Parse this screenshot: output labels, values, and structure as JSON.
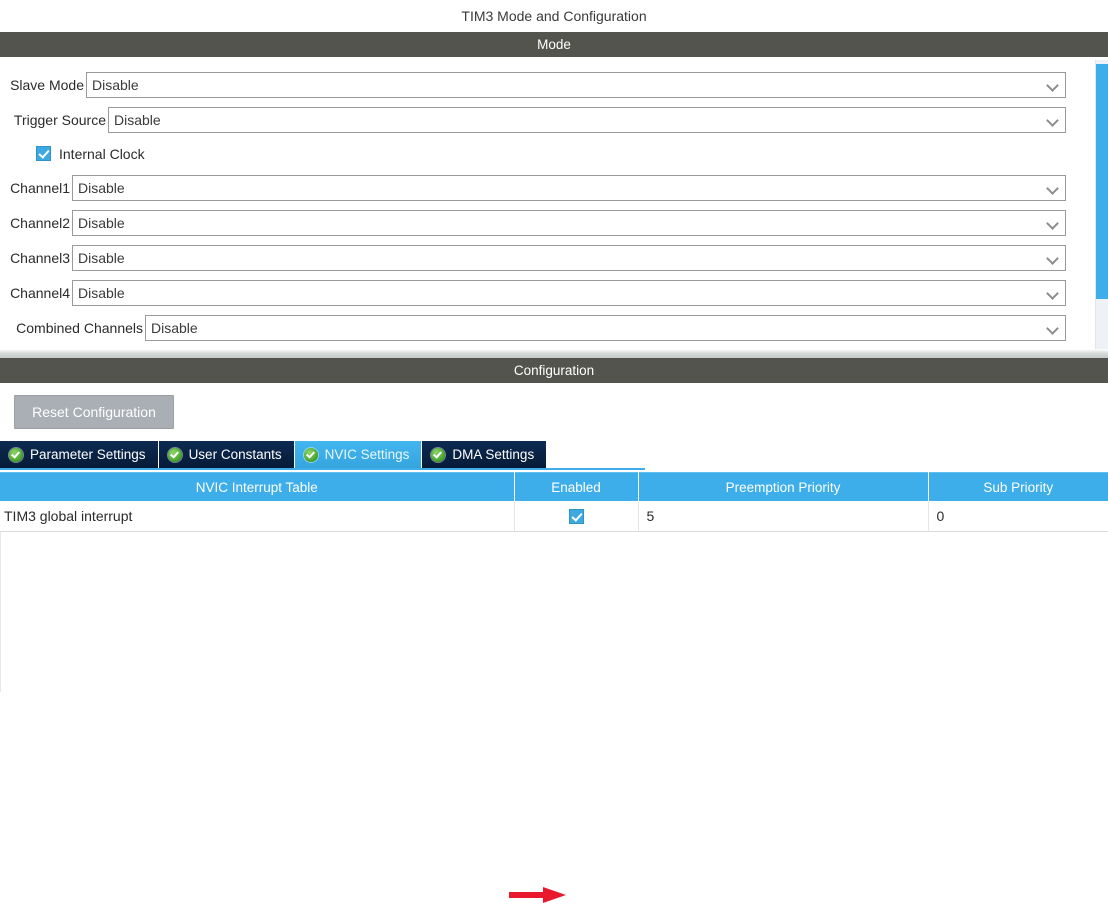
{
  "page_title": "TIM3 Mode and Configuration",
  "sections": {
    "mode_bar": "Mode",
    "configuration_bar": "Configuration"
  },
  "mode": {
    "rows": [
      {
        "label": "Slave Mode",
        "value": "Disable",
        "label_width": 86,
        "icon": "chevron-down-icon"
      },
      {
        "label": "Trigger Source",
        "value": "Disable",
        "label_width": 108,
        "icon": "chevron-down-icon"
      },
      {
        "label": "Channel1",
        "value": "Disable",
        "label_width": 72,
        "icon": "chevron-down-icon"
      },
      {
        "label": "Channel2",
        "value": "Disable",
        "label_width": 72,
        "icon": "chevron-down-icon"
      },
      {
        "label": "Channel3",
        "value": "Disable",
        "label_width": 72,
        "icon": "chevron-down-icon"
      },
      {
        "label": "Channel4",
        "value": "Disable",
        "label_width": 72,
        "icon": "chevron-down-icon"
      },
      {
        "label": "Combined Channels",
        "value": "Disable",
        "label_width": 145,
        "icon": "chevron-down-icon"
      }
    ],
    "internal_clock": {
      "label": "Internal Clock",
      "checked": true
    }
  },
  "configuration": {
    "reset_button": "Reset Configuration",
    "tabs": [
      {
        "label": "Parameter Settings",
        "active": false,
        "icon": "green-check-icon"
      },
      {
        "label": "User Constants",
        "active": false,
        "icon": "green-check-icon"
      },
      {
        "label": "NVIC Settings",
        "active": true,
        "icon": "green-check-icon"
      },
      {
        "label": "DMA Settings",
        "active": false,
        "icon": "green-check-icon"
      }
    ],
    "nvic_table": {
      "columns": [
        "NVIC Interrupt Table",
        "Enabled",
        "Preemption Priority",
        "Sub Priority"
      ],
      "rows": [
        {
          "name": "TIM3 global interrupt",
          "enabled": true,
          "preemption_priority": "5",
          "sub_priority": "0"
        }
      ]
    }
  },
  "annotations": {
    "arrow": {
      "color": "#e8192c",
      "points_to": "enabled-checkbox"
    }
  },
  "colors": {
    "section_bar": "#54544f",
    "accent_cyan": "#3daee9",
    "tab_navy": "#0b2447",
    "checkbox_blue": "#3da9e0",
    "reset_gray": "#a9afb4",
    "arrow_red": "#e8192c"
  },
  "scrollbar": {
    "orientation": "vertical",
    "thumb_color": "#3daee9"
  }
}
